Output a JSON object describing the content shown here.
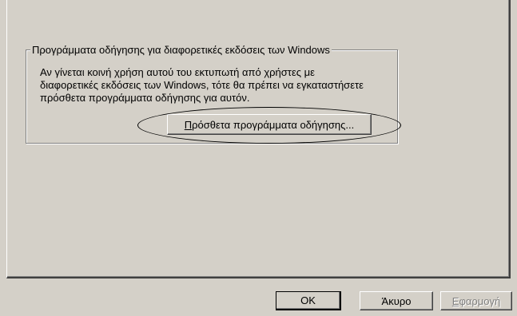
{
  "group": {
    "title": "Προγράμματα οδήγησης για διαφορετικές εκδόσεις των Windows",
    "description": "Αν γίνεται κοινή χρήση αυτού του εκτυπωτή από χρήστες με διαφορετικές εκδόσεις των Windows, τότε θα πρέπει να εγκαταστήσετε πρόσθετα προγράμματα οδήγησης για αυτόν.",
    "additional_drivers_button": "Πρόσθετα προγράμματα οδήγησης..."
  },
  "footer": {
    "ok_label": "OK",
    "cancel_label": "Άκυρο",
    "apply_label": "Εφαρμογή"
  },
  "colors": {
    "dialog_bg": "#d4d0c8",
    "disabled_text": "#808080"
  }
}
